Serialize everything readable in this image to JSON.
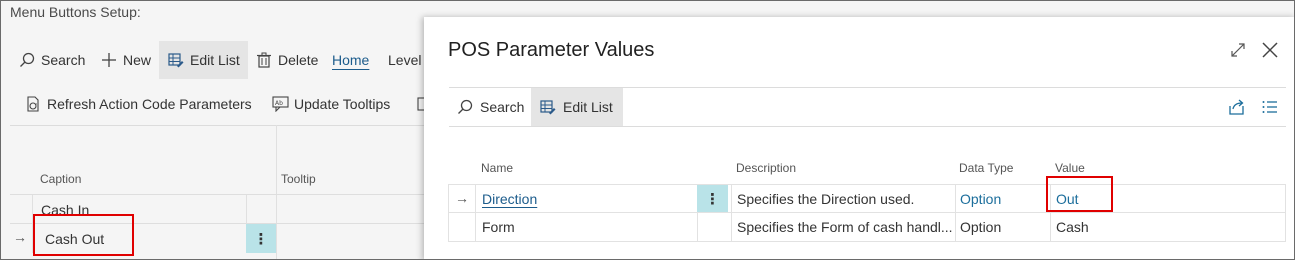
{
  "background": {
    "title": "Menu Buttons Setup:",
    "toolbar": {
      "search": "Search",
      "new": "New",
      "edit_list": "Edit List",
      "delete": "Delete",
      "home": "Home",
      "level": "Level"
    },
    "actions": {
      "refresh": "Refresh Action Code Parameters",
      "update_tooltips": "Update Tooltips"
    },
    "columns": {
      "caption": "Caption",
      "tooltip": "Tooltip"
    },
    "rows": [
      {
        "caption": "Cash In"
      },
      {
        "caption": "Cash Out"
      }
    ]
  },
  "dialog": {
    "title": "POS Parameter Values",
    "toolbar": {
      "search": "Search",
      "edit_list": "Edit List"
    },
    "columns": {
      "name": "Name",
      "description": "Description",
      "data_type": "Data Type",
      "value": "Value"
    },
    "rows": [
      {
        "name": "Direction",
        "description": "Specifies the Direction used.",
        "data_type": "Option",
        "value": "Out"
      },
      {
        "name": "Form",
        "description": "Specifies the Form of cash handl...",
        "data_type": "Option",
        "value": "Cash"
      }
    ]
  },
  "colors": {
    "accent": "#1c5c8c",
    "selected_cell": "#b9e3e8",
    "highlight_box": "#e00000"
  }
}
